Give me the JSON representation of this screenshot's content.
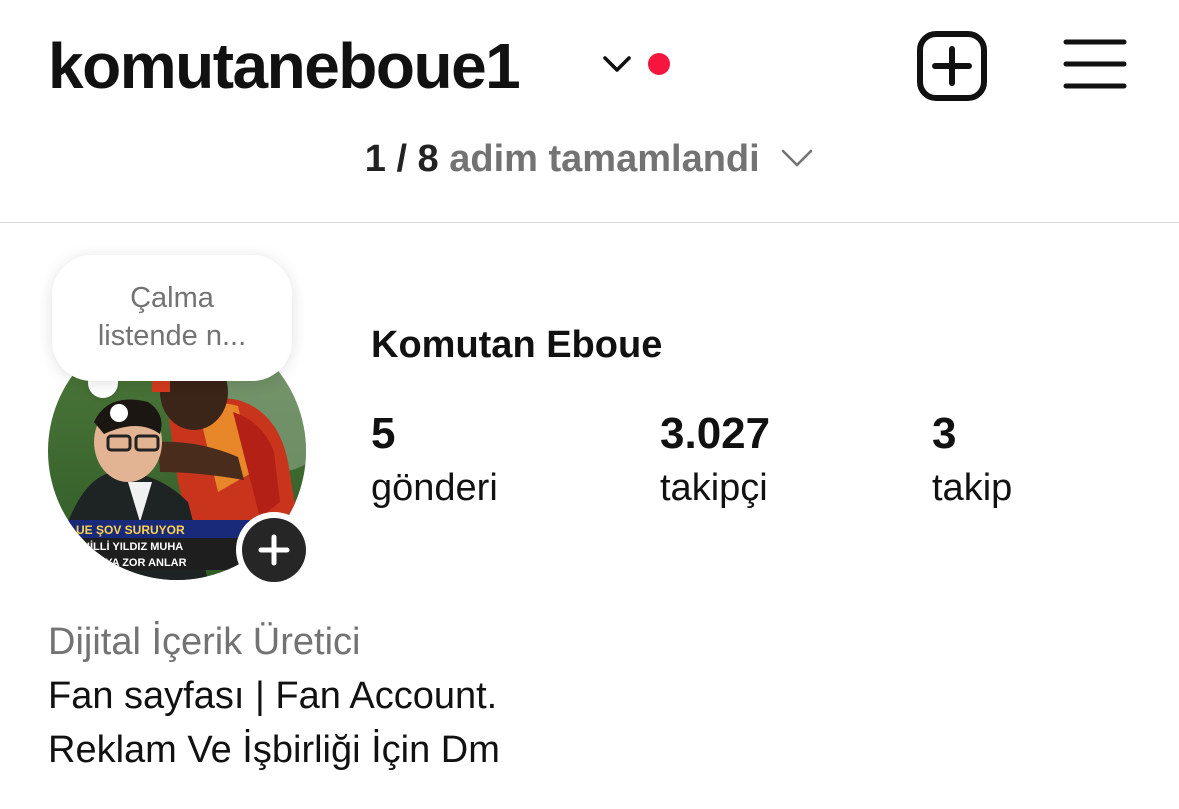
{
  "header": {
    "username": "komutaneboue1",
    "has_notification_dot": true,
    "create_icon": "plus-square-icon",
    "menu_icon": "hamburger-menu-icon"
  },
  "progress": {
    "count": "1 / 8",
    "text": "adim tamamlandi"
  },
  "note": {
    "text": "Çalma listende n..."
  },
  "avatar": {
    "caption_line1": "UE ŞOV SURUYOR",
    "caption_line2": "HİLLİ YILDIZ MUHA",
    "caption_line3": "LU'YA ZOR ANLAR"
  },
  "profile": {
    "display_name": "Komutan Eboue",
    "stats": [
      {
        "value": "5",
        "label": "gönderi"
      },
      {
        "value": "3.027",
        "label": "takipçi"
      },
      {
        "value": "3",
        "label": "takip"
      }
    ],
    "category": "Dijital İçerik Üretici",
    "bio": [
      "Fan sayfası | Fan Account.",
      "Reklam Ve İşbirliği İçin Dm"
    ]
  },
  "colors": {
    "text": "#111111",
    "secondary": "#737373",
    "notification": "#f5153d",
    "divider": "#dbdbdb"
  }
}
